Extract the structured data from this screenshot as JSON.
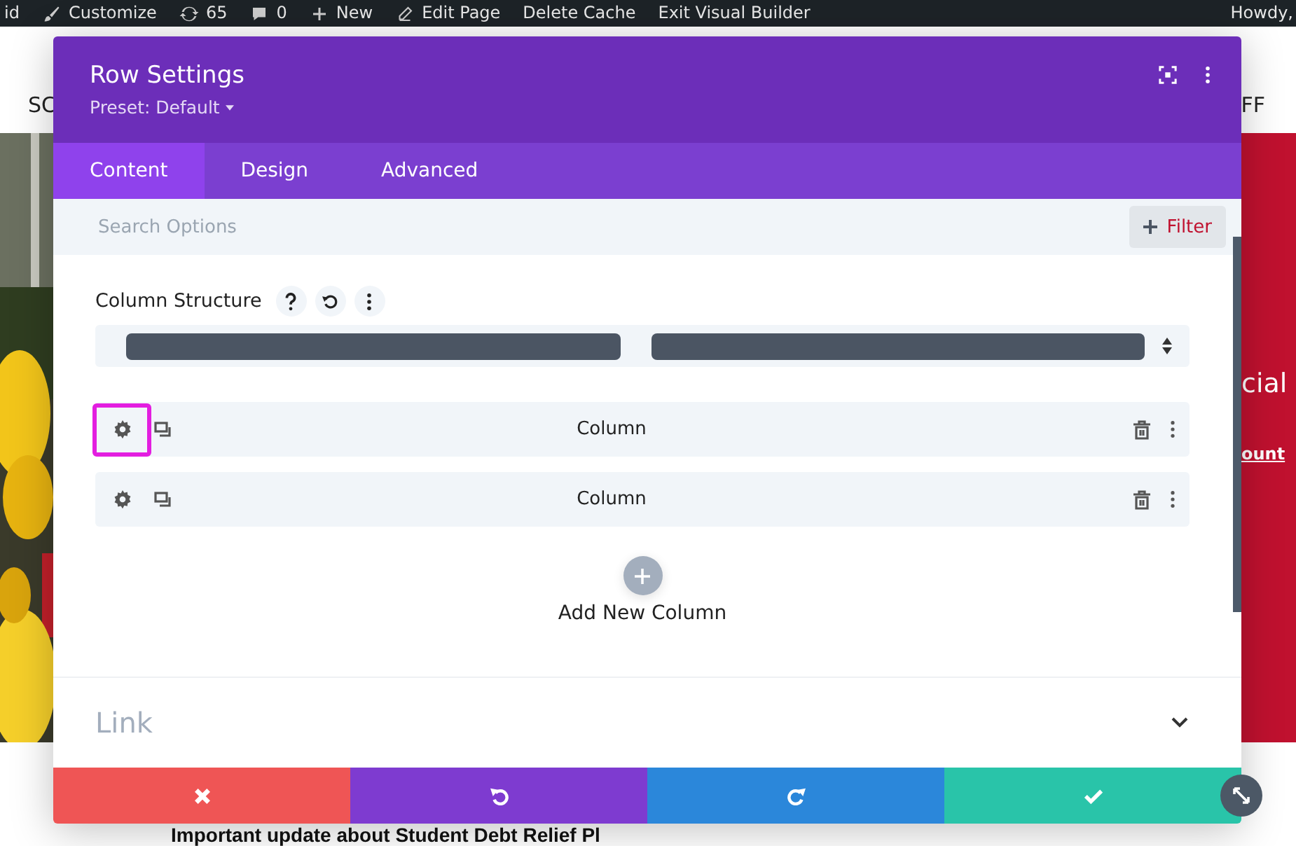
{
  "admin_bar": {
    "items": [
      {
        "kind": "text",
        "label": "id"
      },
      {
        "kind": "brush",
        "label": "Customize"
      },
      {
        "kind": "updates",
        "label": "65"
      },
      {
        "kind": "comment",
        "label": "0"
      },
      {
        "kind": "plus",
        "label": "New"
      },
      {
        "kind": "pencil",
        "label": "Edit Page"
      },
      {
        "kind": "text",
        "label": "Delete Cache"
      },
      {
        "kind": "text",
        "label": "Exit Visual Builder"
      }
    ],
    "greeting": "Howdy,"
  },
  "site_header": {
    "left_text": "SC",
    "right_text": "FF"
  },
  "hero": {
    "heading": "cial",
    "link": "ount"
  },
  "page_heading": "Important update about Student Debt Relief Pl",
  "modal": {
    "title": "Row Settings",
    "preset": "Preset: Default",
    "tabs": [
      {
        "label": "Content",
        "selected": true
      },
      {
        "label": "Design",
        "selected": false
      },
      {
        "label": "Advanced",
        "selected": false
      }
    ],
    "search": {
      "placeholder": "Search Options"
    },
    "filter_label": "Filter",
    "column_structure": {
      "label": "Column Structure"
    },
    "columns": [
      {
        "label": "Column",
        "highlighted": true
      },
      {
        "label": "Column",
        "highlighted": false
      }
    ],
    "add_label": "Add New Column",
    "sections": [
      {
        "label": "Link",
        "expanded": false
      }
    ],
    "footer": [
      {
        "kind": "discard"
      },
      {
        "kind": "undo"
      },
      {
        "kind": "redo"
      },
      {
        "kind": "save"
      }
    ]
  }
}
